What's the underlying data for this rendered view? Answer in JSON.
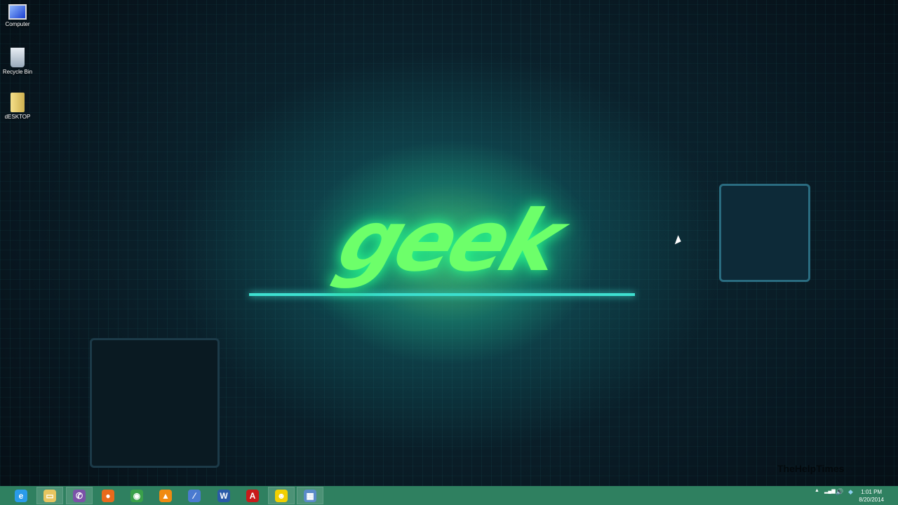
{
  "wallpaper": {
    "logo_text": "geek"
  },
  "watermark": "TheHelpTimes",
  "desktop_icons": [
    {
      "label": "Computer",
      "icon": "computer-icon"
    },
    {
      "label": "Recycle Bin",
      "icon": "recycle-bin-icon"
    },
    {
      "label": "dESKTOP",
      "icon": "folder-icon"
    }
  ],
  "taskbar": {
    "items": [
      {
        "name": "internet-explorer",
        "glyph": "e",
        "color": "#2a9bea"
      },
      {
        "name": "file-explorer",
        "glyph": "▭",
        "color": "#e8c560"
      },
      {
        "name": "viber",
        "glyph": "✆",
        "color": "#7b52a8"
      },
      {
        "name": "firefox",
        "glyph": "●",
        "color": "#e86a1c"
      },
      {
        "name": "chrome",
        "glyph": "◉",
        "color": "#3aa04a"
      },
      {
        "name": "vlc",
        "glyph": "▲",
        "color": "#f08a10"
      },
      {
        "name": "paint",
        "glyph": "⁄",
        "color": "#4a7ad0"
      },
      {
        "name": "word",
        "glyph": "W",
        "color": "#2a5aa8"
      },
      {
        "name": "acrobat",
        "glyph": "A",
        "color": "#c81a1a"
      },
      {
        "name": "cyberghost",
        "glyph": "☻",
        "color": "#f2d000"
      },
      {
        "name": "control-panel",
        "glyph": "▦",
        "color": "#5a8ac8"
      }
    ]
  },
  "tray": {
    "show_hidden": "▲",
    "network": "▂▄▆",
    "volume": "🔊",
    "dropbox": "◆",
    "time": "1:01 PM",
    "date": "8/20/2014"
  }
}
